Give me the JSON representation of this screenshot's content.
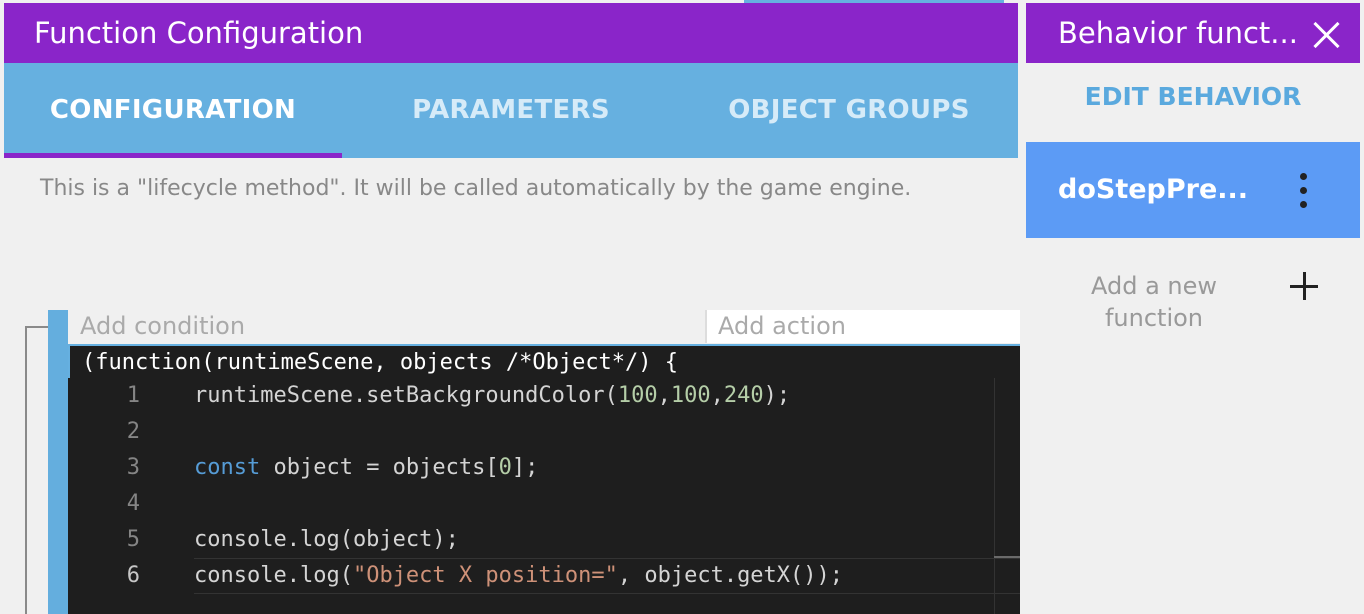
{
  "window": {
    "title": "Function Configuration"
  },
  "tabs": [
    {
      "label": "CONFIGURATION",
      "active": true
    },
    {
      "label": "PARAMETERS",
      "active": false
    },
    {
      "label": "OBJECT GROUPS",
      "active": false
    }
  ],
  "description": "This is a \"lifecycle method\". It will be called automatically by the game engine.",
  "event": {
    "add_condition": "Add condition",
    "add_action": "Add action"
  },
  "code": {
    "header": "(function(runtimeScene, objects /*Object*/) {",
    "current_line": 6,
    "lines": [
      {
        "num": "1"
      },
      {
        "num": "2"
      },
      {
        "num": "3"
      },
      {
        "num": "4"
      },
      {
        "num": "5"
      },
      {
        "num": "6"
      }
    ],
    "tokens": {
      "l1_a": "runtimeScene.setBackgroundColor(",
      "l1_n1": "100",
      "l1_c1": ",",
      "l1_n2": "100",
      "l1_c2": ",",
      "l1_n3": "240",
      "l1_b": ");",
      "l3_kw": "const",
      "l3_a": " object = objects[",
      "l3_n": "0",
      "l3_b": "];",
      "l5": "console.log(object);",
      "l6_a": "console.log(",
      "l6_str": "\"Object X position=\"",
      "l6_b": ", object.getX());"
    }
  },
  "sidebar": {
    "title": "Behavior funct...",
    "edit_behavior": "EDIT BEHAVIOR",
    "selected_function": "doStepPre...",
    "add_function": "Add a new function"
  },
  "colors": {
    "title_bar": "#8a25c9",
    "tab_bar": "#66b0e0",
    "selected_item": "#5c9bf5",
    "code_bg": "#1e1e1e"
  },
  "icons": [
    "close-icon",
    "more-vert-icon",
    "plus-icon"
  ]
}
